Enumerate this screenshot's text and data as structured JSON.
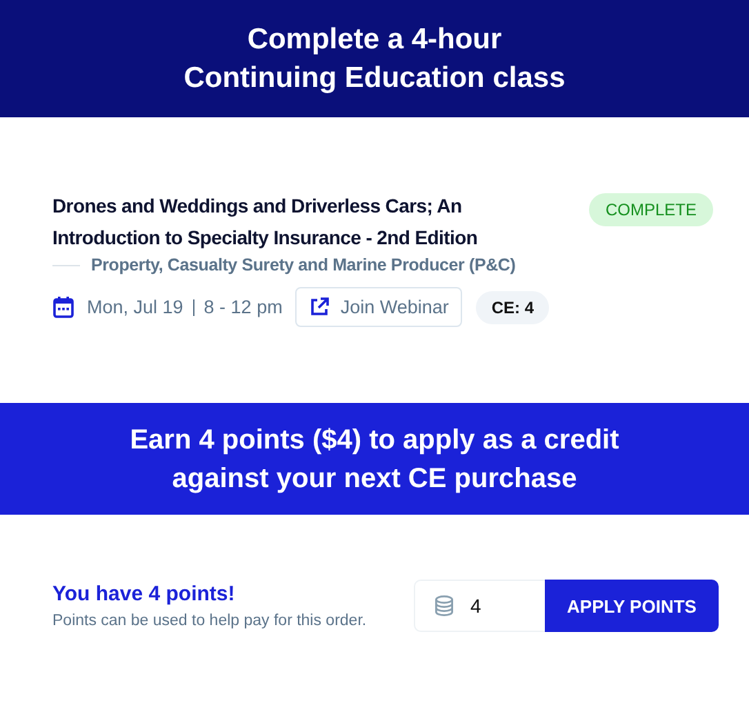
{
  "header": {
    "title": "Complete a 4-hour Continuing Education class"
  },
  "course": {
    "title": "Drones and Weddings and Driverless Cars; An Introduction to Specialty Insurance - 2nd Edition",
    "status": "COMPLETE",
    "category": "Property, Casualty Surety and Marine Producer (P&C)",
    "date": "Mon, Jul 19",
    "time": "8 - 12 pm",
    "webinar_button": "Join Webinar",
    "ce_badge": "CE: 4"
  },
  "earn_banner": {
    "text": "Earn 4 points ($4) to apply as a credit against your next CE purchase"
  },
  "points": {
    "title": "You have 4 points!",
    "note": "Points can be used to help pay for this order.",
    "field_value": "4",
    "apply_button": "APPLY POINTS"
  }
}
